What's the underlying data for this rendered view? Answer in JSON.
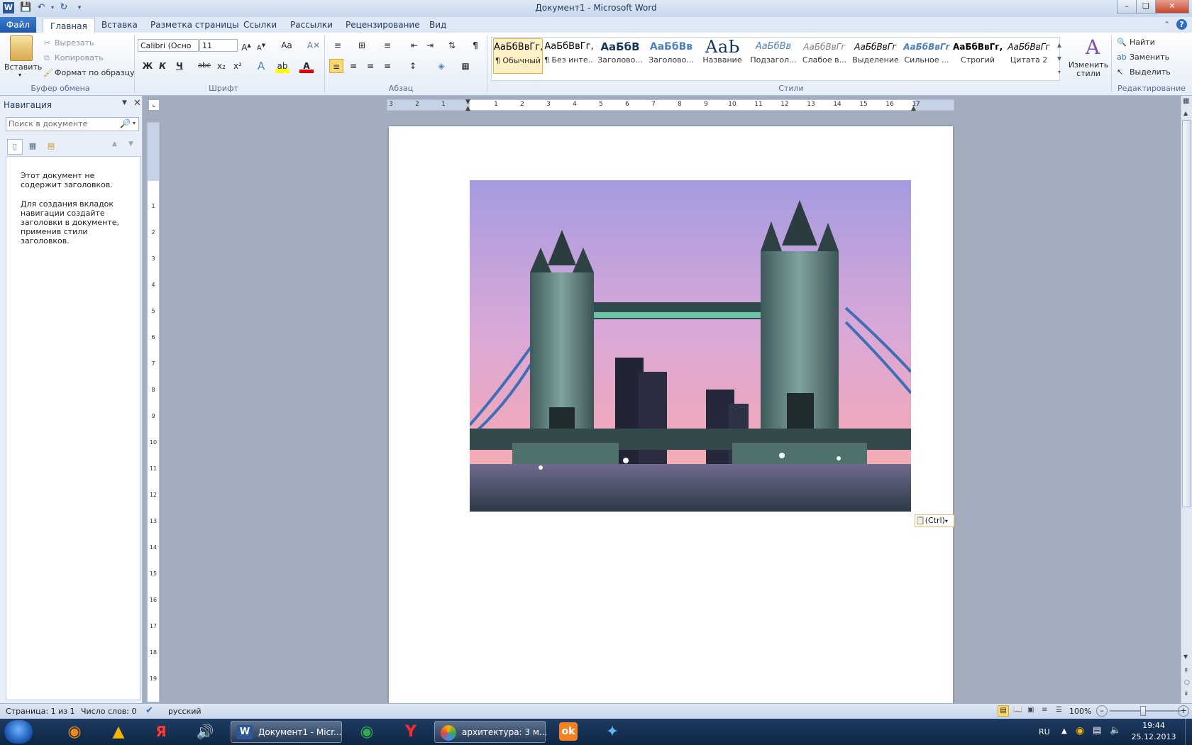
{
  "window": {
    "title": "Документ1 - Microsoft Word",
    "qat_icons": [
      "word-logo-icon",
      "save-icon",
      "undo-icon",
      "redo-icon",
      "customize-qat-icon"
    ]
  },
  "ribbon_tabs": [
    "Файл",
    "Главная",
    "Вставка",
    "Разметка страницы",
    "Ссылки",
    "Рассылки",
    "Рецензирование",
    "Вид"
  ],
  "clipboard": {
    "paste": "Вставить",
    "cut": "Вырезать",
    "copy": "Копировать",
    "format_painter": "Формат по образцу",
    "group_label": "Буфер обмена"
  },
  "font": {
    "family": "Calibri (Осно",
    "size": "11",
    "group_label": "Шрифт",
    "buttons": [
      "Ж",
      "К",
      "Ч",
      "abc",
      "x₂",
      "x²"
    ]
  },
  "paragraph": {
    "group_label": "Абзац"
  },
  "styles": {
    "group_label": "Стили",
    "items": [
      {
        "sample": "АаБбВвГг,",
        "name": "¶ Обычный",
        "color": "#000000"
      },
      {
        "sample": "АаБбВвГг,",
        "name": "¶ Без инте...",
        "color": "#000000"
      },
      {
        "sample": "АаБбВ",
        "name": "Заголово...",
        "color": "#17365d"
      },
      {
        "sample": "АаБбВв",
        "name": "Заголово...",
        "color": "#4f81bd"
      },
      {
        "sample": "АаЬ",
        "name": "Название",
        "color": "#17365d"
      },
      {
        "sample": "АаБбВв",
        "name": "Подзагол...",
        "color": "#4f81bd"
      },
      {
        "sample": "АаБбВвГг",
        "name": "Слабое в...",
        "color": "#808080"
      },
      {
        "sample": "АаБбВвГг",
        "name": "Выделение",
        "color": "#000000"
      },
      {
        "sample": "АаБбВвГг",
        "name": "Сильное ...",
        "color": "#4f81bd"
      },
      {
        "sample": "АаБбВвГг,",
        "name": "Строгий",
        "color": "#000000"
      },
      {
        "sample": "АаБбВвГг",
        "name": "Цитата 2",
        "color": "#000000"
      }
    ],
    "change_styles": "Изменить стили"
  },
  "editing": {
    "group_label": "Редактирование",
    "find": "Найти",
    "replace": "Заменить",
    "select": "Выделить"
  },
  "nav_pane": {
    "title": "Навигация",
    "search_placeholder": "Поиск в документе",
    "message1": "Этот документ не содержит заголовков.",
    "message2": "Для создания вкладок навигации создайте заголовки в документе, применив стили заголовков."
  },
  "ruler": {
    "h_labels": [
      "3",
      "2",
      "1",
      "1",
      "2",
      "3",
      "4",
      "5",
      "6",
      "7",
      "8",
      "9",
      "10",
      "11",
      "12",
      "13",
      "14",
      "15",
      "16",
      "17"
    ],
    "v_labels": [
      "1",
      "2",
      "3",
      "4",
      "5",
      "6",
      "7",
      "8",
      "9",
      "10",
      "11",
      "12",
      "13",
      "14",
      "15",
      "16",
      "17",
      "18",
      "19"
    ]
  },
  "document": {
    "image_subject": "tower-bridge-photo",
    "paste_options": "(Ctrl)"
  },
  "status_bar": {
    "page": "Страница: 1 из 1",
    "words": "Число слов: 0",
    "language": "русский",
    "zoom": "100%"
  },
  "taskbar": {
    "items": [
      {
        "label": "",
        "icon": "firefox-icon"
      },
      {
        "label": "",
        "icon": "aimp-icon"
      },
      {
        "label": "",
        "icon": "yandex-browser-icon"
      },
      {
        "label": "",
        "icon": "speaker-app-icon"
      },
      {
        "label": "Документ1 - Micr...",
        "icon": "word-icon"
      },
      {
        "label": "",
        "icon": "chrome-icon"
      },
      {
        "label": "",
        "icon": "yandex-icon"
      },
      {
        "label": "архитектура: 3 м...",
        "icon": "picasa-icon"
      },
      {
        "label": "",
        "icon": "odnoklassniki-icon"
      },
      {
        "label": "",
        "icon": "skype-like-icon"
      }
    ],
    "language": "RU",
    "time": "19:44",
    "date": "25.12.2013"
  }
}
